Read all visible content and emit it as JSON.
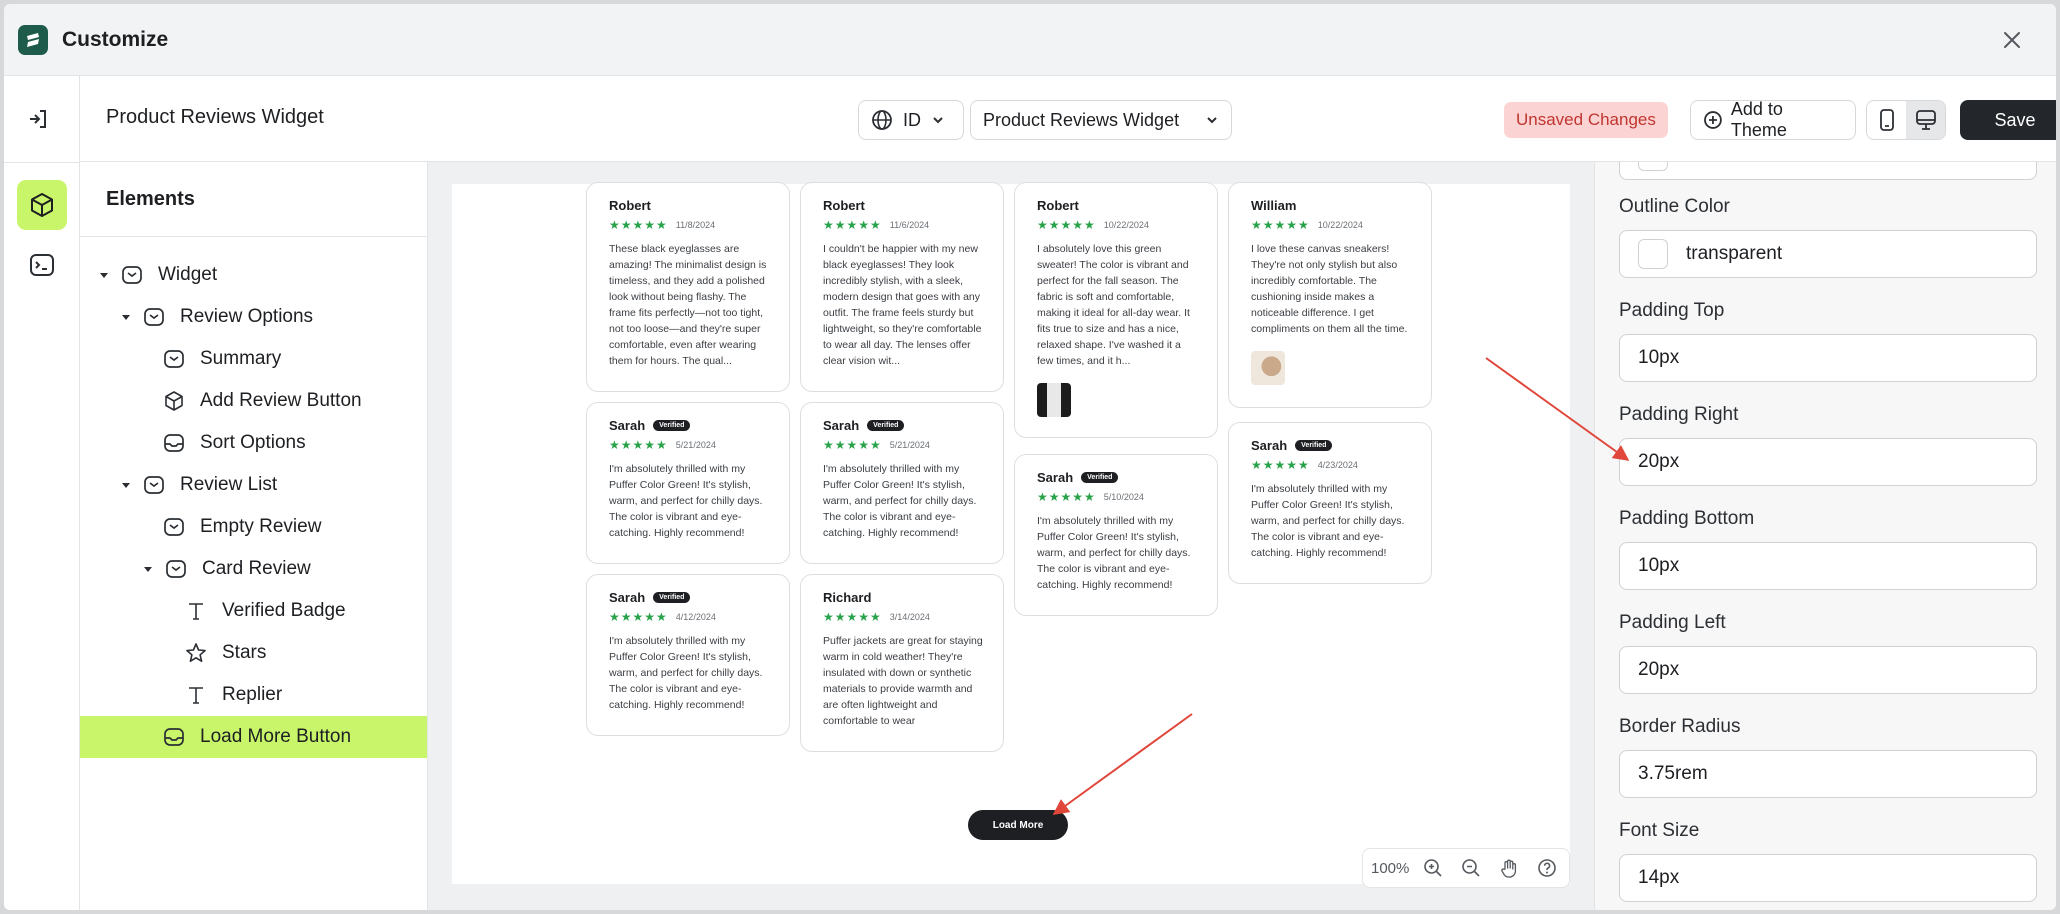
{
  "app": {
    "title": "Customize"
  },
  "header": {
    "page_title": "Product Reviews Widget",
    "language_select": "ID",
    "widget_select": "Product Reviews Widget",
    "unsaved_label": "Unsaved Changes",
    "add_to_theme_label": "Add to Theme",
    "save_label": "Save"
  },
  "elements": {
    "title": "Elements",
    "tree": [
      {
        "label": "Widget",
        "icon": "widget-icon"
      },
      {
        "label": "Review Options",
        "icon": "widget-icon"
      },
      {
        "label": "Summary",
        "icon": "widget-icon"
      },
      {
        "label": "Add Review Button",
        "icon": "cube-icon"
      },
      {
        "label": "Sort Options",
        "icon": "inbox-icon"
      },
      {
        "label": "Review List",
        "icon": "widget-icon"
      },
      {
        "label": "Empty Review",
        "icon": "widget-icon"
      },
      {
        "label": "Card Review",
        "icon": "widget-icon"
      },
      {
        "label": "Verified Badge",
        "icon": "text-icon"
      },
      {
        "label": "Stars",
        "icon": "star-icon"
      },
      {
        "label": "Replier",
        "icon": "text-icon"
      },
      {
        "label": "Load More Button",
        "icon": "inbox-icon"
      }
    ]
  },
  "preview": {
    "badge_label": "Verified",
    "load_more_label": "Load More",
    "reviews": [
      {
        "name": "Robert",
        "date": "11/8/2024",
        "verified": false,
        "text": "These black eyeglasses are amazing! The minimalist design is timeless, and they add a polished look without being flashy. The frame fits perfectly—not too tight, not too loose—and they're super comfortable, even after wearing them for hours. The qual..."
      },
      {
        "name": "Sarah",
        "date": "5/21/2024",
        "verified": true,
        "text": "I'm absolutely thrilled with my Puffer Color Green! It's stylish, warm, and perfect for chilly days. The color is vibrant and eye-catching. Highly recommend!"
      },
      {
        "name": "Sarah",
        "date": "4/12/2024",
        "verified": true,
        "text": "I'm absolutely thrilled with my Puffer Color Green! It's stylish, warm, and perfect for chilly days. The color is vibrant and eye-catching. Highly recommend!"
      },
      {
        "name": "Robert",
        "date": "11/6/2024",
        "verified": false,
        "text": "I couldn't be happier with my new black eyeglasses! They look incredibly stylish, with a sleek, modern design that goes with any outfit. The frame feels sturdy but lightweight, so they're comfortable to wear all day. The lenses offer clear vision wit..."
      },
      {
        "name": "Sarah",
        "date": "5/21/2024",
        "verified": true,
        "text": "I'm absolutely thrilled with my Puffer Color Green! It's stylish, warm, and perfect for chilly days. The color is vibrant and eye-catching. Highly recommend!"
      },
      {
        "name": "Richard",
        "date": "3/14/2024",
        "verified": false,
        "text": "Puffer jackets are great for staying warm in cold weather! They're insulated with down or synthetic materials to provide warmth and are often lightweight and comfortable to wear"
      },
      {
        "name": "Robert",
        "date": "10/22/2024",
        "verified": false,
        "text": "I absolutely love this green sweater! The color is vibrant and perfect for the fall season. The fabric is soft and comfortable, making it ideal for all-day wear. It fits true to size and has a nice, relaxed shape. I've washed it a few times, and it h..."
      },
      {
        "name": "Sarah",
        "date": "5/10/2024",
        "verified": true,
        "text": "I'm absolutely thrilled with my Puffer Color Green! It's stylish, warm, and perfect for chilly days. The color is vibrant and eye-catching. Highly recommend!"
      },
      {
        "name": "William",
        "date": "10/22/2024",
        "verified": false,
        "text": "I love these canvas sneakers! They're not only stylish but also incredibly comfortable. The cushioning inside makes a noticeable difference. I get compliments on them all the time."
      },
      {
        "name": "Sarah",
        "date": "4/23/2024",
        "verified": true,
        "text": "I'm absolutely thrilled with my Puffer Color Green! It's stylish, warm, and perfect for chilly days. The color is vibrant and eye-catching. Highly recommend!"
      }
    ],
    "zoom_level": "100%"
  },
  "properties": [
    {
      "label": "Outline Color",
      "value": "transparent",
      "swatch": true
    },
    {
      "label": "Padding Top",
      "value": "10px"
    },
    {
      "label": "Padding Right",
      "value": "20px"
    },
    {
      "label": "Padding Bottom",
      "value": "10px"
    },
    {
      "label": "Padding Left",
      "value": "20px"
    },
    {
      "label": "Border Radius",
      "value": "3.75rem"
    },
    {
      "label": "Font Size",
      "value": "14px"
    }
  ],
  "colors": {
    "accent": "#c9f56a",
    "star": "#29a34a",
    "annotation_arrow": "#e0463a",
    "save_bg": "#23262a"
  }
}
